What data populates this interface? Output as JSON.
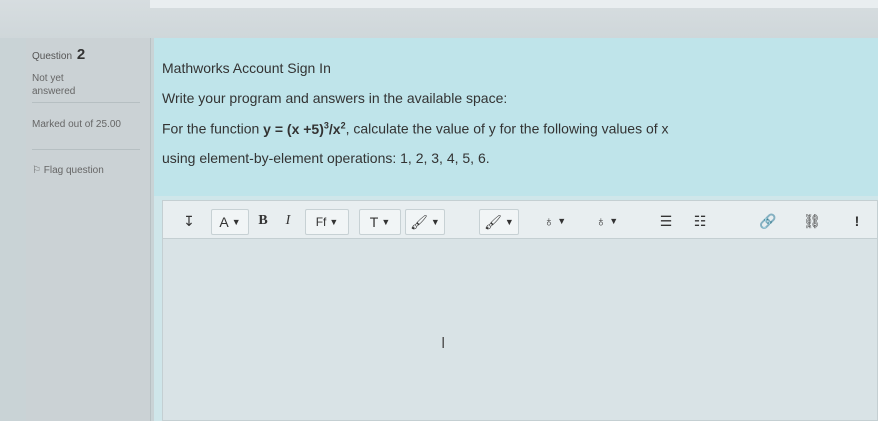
{
  "question": {
    "label": "Question",
    "number": "2",
    "status": "Not yet answered",
    "marks": "Marked out of 25.00",
    "flag": "Flag question"
  },
  "prompt": {
    "title": "Mathworks Account Sign In",
    "instruction": "Write your program and answers in the available space:",
    "function_prefix": "For the function",
    "function_y": "y = (x +5)",
    "exp1": "3",
    "function_mid": "/x",
    "exp2": "2",
    "function_suffix": ", calculate the value of y for the following values of x",
    "values_line": "using element-by-element operations: 1, 2, 3, 4, 5, 6."
  },
  "toolbar": {
    "collapse": "↧",
    "font_color": "A",
    "bold": "B",
    "italic": "I",
    "font_family": "Ff",
    "font_size": "T",
    "important": "!"
  },
  "colors": {
    "question_bg": "#bfe4ea",
    "panel_bg": "#cbd2d5",
    "editor_bg": "#d9e3e6"
  }
}
